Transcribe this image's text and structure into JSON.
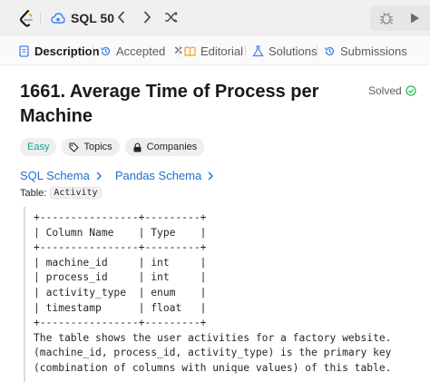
{
  "nav": {
    "list_name": "SQL 50",
    "icons": {
      "logo": "leetcode-logo",
      "list": "cloud-icon",
      "prev": "chevron-left-icon",
      "next": "chevron-right-icon",
      "shuffle": "shuffle-icon",
      "debug": "bug-icon",
      "run": "play-icon"
    }
  },
  "tabs": [
    {
      "label": "Description",
      "icon": "document-icon",
      "active": true
    },
    {
      "label": "Accepted",
      "icon": "history-icon",
      "closable": true
    },
    {
      "label": "Editorial",
      "icon": "book-icon"
    },
    {
      "label": "Solutions",
      "icon": "flask-icon"
    },
    {
      "label": "Submissions",
      "icon": "history-icon"
    }
  ],
  "problem": {
    "title_line1": "1661. Average Time of Process per",
    "title_line2": "Machine",
    "status": "Solved",
    "difficulty": "Easy",
    "topics_label": "Topics",
    "companies_label": "Companies",
    "links": [
      "SQL Schema",
      "Pandas Schema"
    ],
    "table_prefix": "Table:",
    "table_name": "Activity",
    "schema_text": "+----------------+---------+\n| Column Name    | Type    |\n+----------------+---------+\n| machine_id     | int     |\n| process_id     | int     |\n| activity_type  | enum    |\n| timestamp      | float   |\n+----------------+---------+\nThe table shows the user activities for a factory website.\n(machine_id, process_id, activity_type) is the primary key\n(combination of columns with unique values) of this table."
  },
  "colors": {
    "easy": "#1aa39a",
    "link": "#1f6fcf",
    "solved_check": "#2cbb5d"
  }
}
